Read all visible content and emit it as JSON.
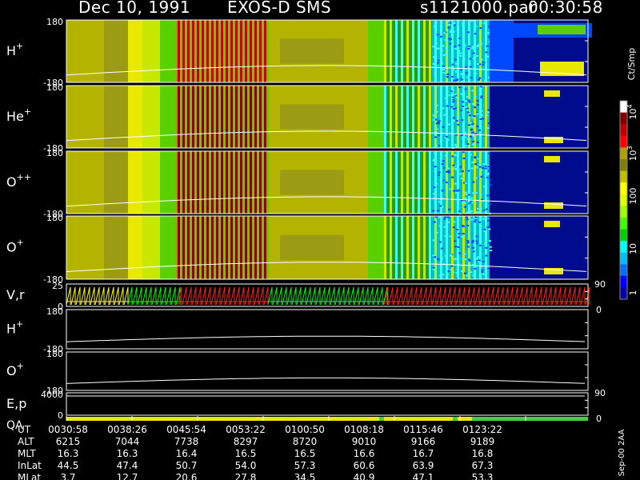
{
  "header": {
    "date": "Dec 10, 1991",
    "instrument": "EXOS-D SMS",
    "file": "s1121000.par",
    "time": "00:30:58"
  },
  "chart_data": {
    "type": "heatmap",
    "panels": [
      {
        "label": "H",
        "sup": "+",
        "ytop": "180",
        "ybot": "-180",
        "kind": "spectrogram"
      },
      {
        "label": "He",
        "sup": "+",
        "ytop": "180",
        "ybot": "-180",
        "kind": "spectrogram"
      },
      {
        "label": "O",
        "sup": "++",
        "ytop": "180",
        "ybot": "-180",
        "kind": "spectrogram"
      },
      {
        "label": "O",
        "sup": "+",
        "ytop": "180",
        "ybot": "-180",
        "kind": "spectrogram"
      },
      {
        "label": "V,r",
        "sup": "",
        "ytop": "25",
        "ybot": "0",
        "right_top": "90",
        "right_bot": "0",
        "kind": "mode"
      },
      {
        "label": "H",
        "sup": "+",
        "ytop": "180",
        "ybot": "-180",
        "kind": "line"
      },
      {
        "label": "O",
        "sup": "+",
        "ytop": "180",
        "ybot": "-180",
        "kind": "line"
      },
      {
        "label": "E,p",
        "sup": "",
        "ytop": "4000",
        "ybot": "0",
        "right_top": "90",
        "right_bot": "0",
        "sublabel": "QA",
        "kind": "line"
      }
    ],
    "colorbar": {
      "unit": "Ct/Smp",
      "ticks": [
        "1",
        "10",
        "100",
        "10",
        "10"
      ],
      "tick_exps": [
        "",
        "",
        "",
        "3",
        "4"
      ],
      "colors": [
        "#0000aa",
        "#0000ff",
        "#0070ff",
        "#00c0ff",
        "#00ffff",
        "#00d000",
        "#40ff00",
        "#a0ff00",
        "#e0ff00",
        "#ffff00",
        "#c0c000",
        "#808000",
        "#b0a000",
        "#ff0000",
        "#c00000",
        "#800000",
        "#ffffff"
      ]
    },
    "side_note": "Sep-00 2AA",
    "time_axis": {
      "ticks": [
        "0030:58",
        "0038:26",
        "0045:54",
        "0053:22",
        "0100:50",
        "0108:18",
        "0115:46",
        "0123:22"
      ]
    },
    "ephemeris": [
      {
        "name": "UT",
        "values": [
          "0030:58",
          "0038:26",
          "0045:54",
          "0053:22",
          "0100:50",
          "0108:18",
          "0115:46",
          "0123:22"
        ]
      },
      {
        "name": "ALT",
        "values": [
          "6215",
          "7044",
          "7738",
          "8297",
          "8720",
          "9010",
          "9166",
          "9189"
        ]
      },
      {
        "name": "MLT",
        "values": [
          "16.3",
          "16.3",
          "16.4",
          "16.5",
          "16.5",
          "16.6",
          "16.7",
          "16.8"
        ]
      },
      {
        "name": "InLat",
        "values": [
          "44.5",
          "47.4",
          "50.7",
          "54.0",
          "57.3",
          "60.6",
          "63.9",
          "67.3"
        ]
      },
      {
        "name": "MLat",
        "values": [
          "3.7",
          "12.7",
          "20.6",
          "27.8",
          "34.5",
          "40.9",
          "47.1",
          "53.3"
        ]
      }
    ]
  }
}
